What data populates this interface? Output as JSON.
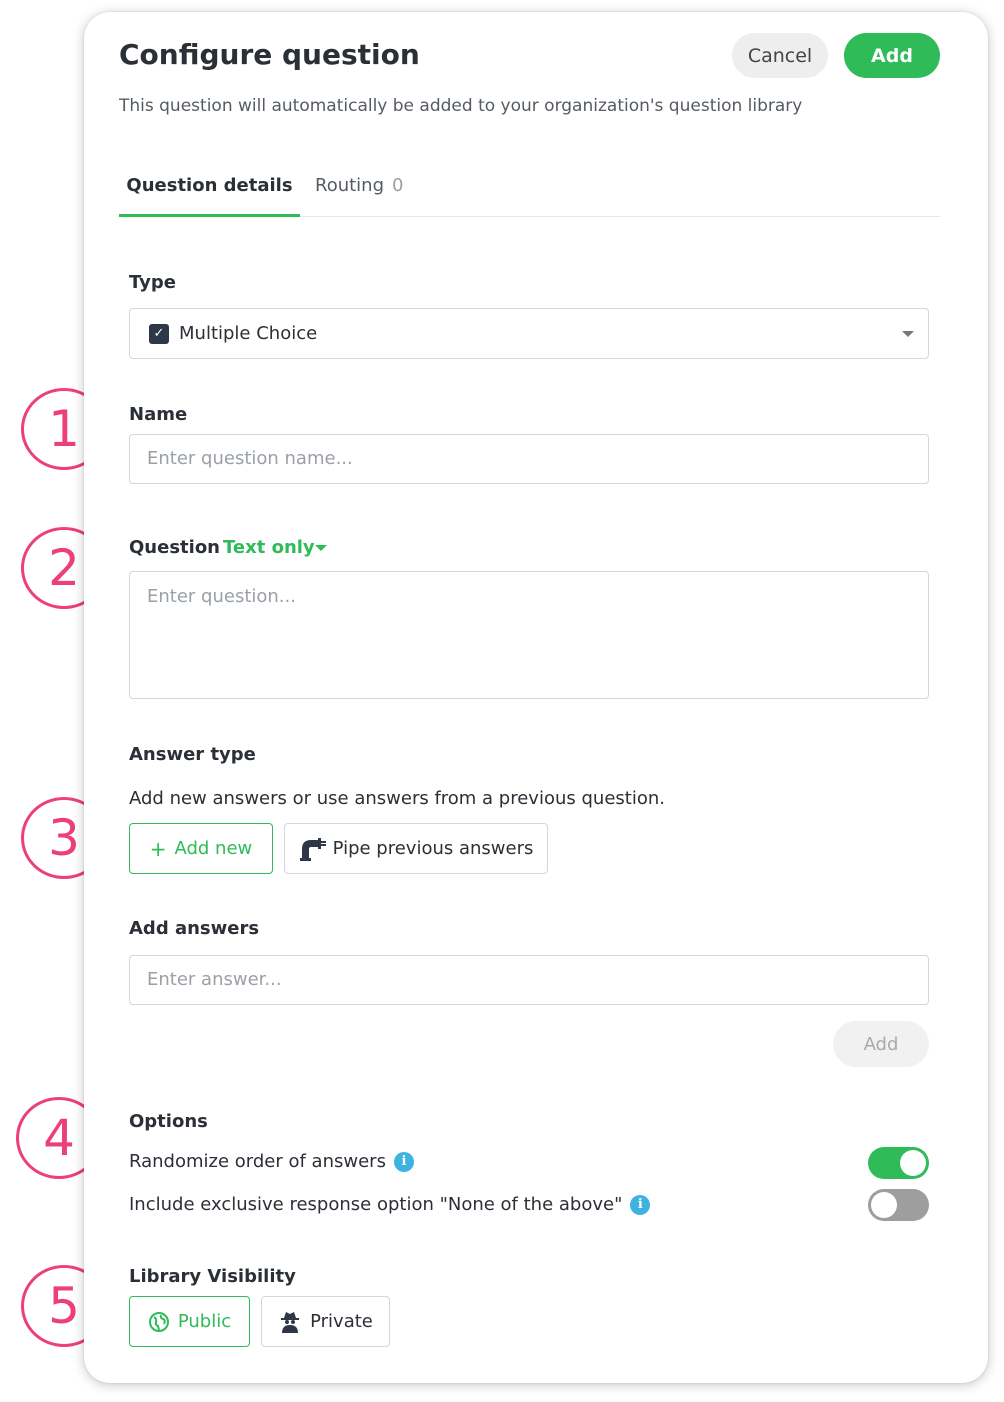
{
  "header": {
    "title": "Configure question",
    "cancel_label": "Cancel",
    "add_label": "Add",
    "subtitle": "This question will automatically be added to your organization's question library"
  },
  "tabs": [
    {
      "label": "Question details",
      "active": true
    },
    {
      "label": "Routing",
      "count": "0"
    }
  ],
  "type_field": {
    "label": "Type",
    "value": "Multiple Choice",
    "icon": "checkbox-icon"
  },
  "name_field": {
    "label": "Name",
    "placeholder": "Enter question name..."
  },
  "question_field": {
    "label": "Question",
    "format": "Text only",
    "placeholder": "Enter question..."
  },
  "answer_type": {
    "label": "Answer type",
    "helper": "Add new answers or use answers from a previous question.",
    "add_new": "Add new",
    "pipe": "Pipe previous answers"
  },
  "add_answers": {
    "label": "Add answers",
    "placeholder": "Enter answer...",
    "button": "Add"
  },
  "options": {
    "label": "Options",
    "items": [
      {
        "label": "Randomize order of answers",
        "enabled": true
      },
      {
        "label": "Include exclusive response option \"None of the above\"",
        "enabled": false
      }
    ]
  },
  "visibility": {
    "label": "Library Visibility",
    "public": "Public",
    "private": "Private"
  },
  "annotations": [
    "1",
    "2",
    "3",
    "4",
    "5"
  ],
  "colors": {
    "accent": "#2fbb58",
    "annotation": "#ec3f7b",
    "info": "#3fb3e0"
  }
}
